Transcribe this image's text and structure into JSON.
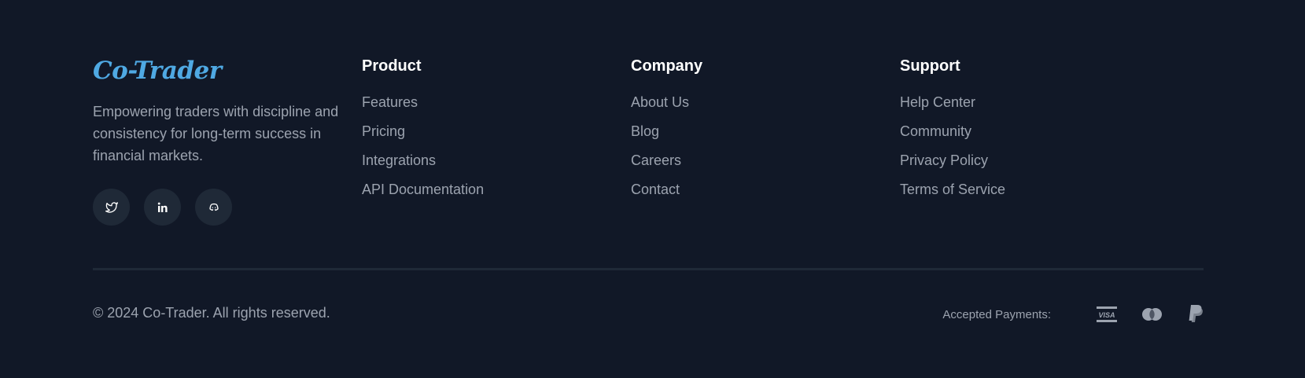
{
  "brand": {
    "logo": "Co-Trader",
    "tagline": "Empowering traders with discipline and consistency for long-term success in financial markets."
  },
  "socials": [
    {
      "icon": "twitter-icon"
    },
    {
      "icon": "linkedin-icon"
    },
    {
      "icon": "discord-icon"
    }
  ],
  "columns": [
    {
      "title": "Product",
      "links": [
        "Features",
        "Pricing",
        "Integrations",
        "API Documentation"
      ]
    },
    {
      "title": "Company",
      "links": [
        "About Us",
        "Blog",
        "Careers",
        "Contact"
      ]
    },
    {
      "title": "Support",
      "links": [
        "Help Center",
        "Community",
        "Privacy Policy",
        "Terms of Service"
      ]
    }
  ],
  "bottom": {
    "copyright": "© 2024 Co-Trader. All rights reserved.",
    "payments_label": "Accepted Payments:",
    "payment_icons": [
      "visa-icon",
      "mastercard-icon",
      "paypal-icon"
    ]
  },
  "colors": {
    "background": "#111827",
    "accent": "#4fa9e3",
    "text_muted": "#9ca3af",
    "heading": "#ffffff",
    "surface": "#1f2937"
  }
}
